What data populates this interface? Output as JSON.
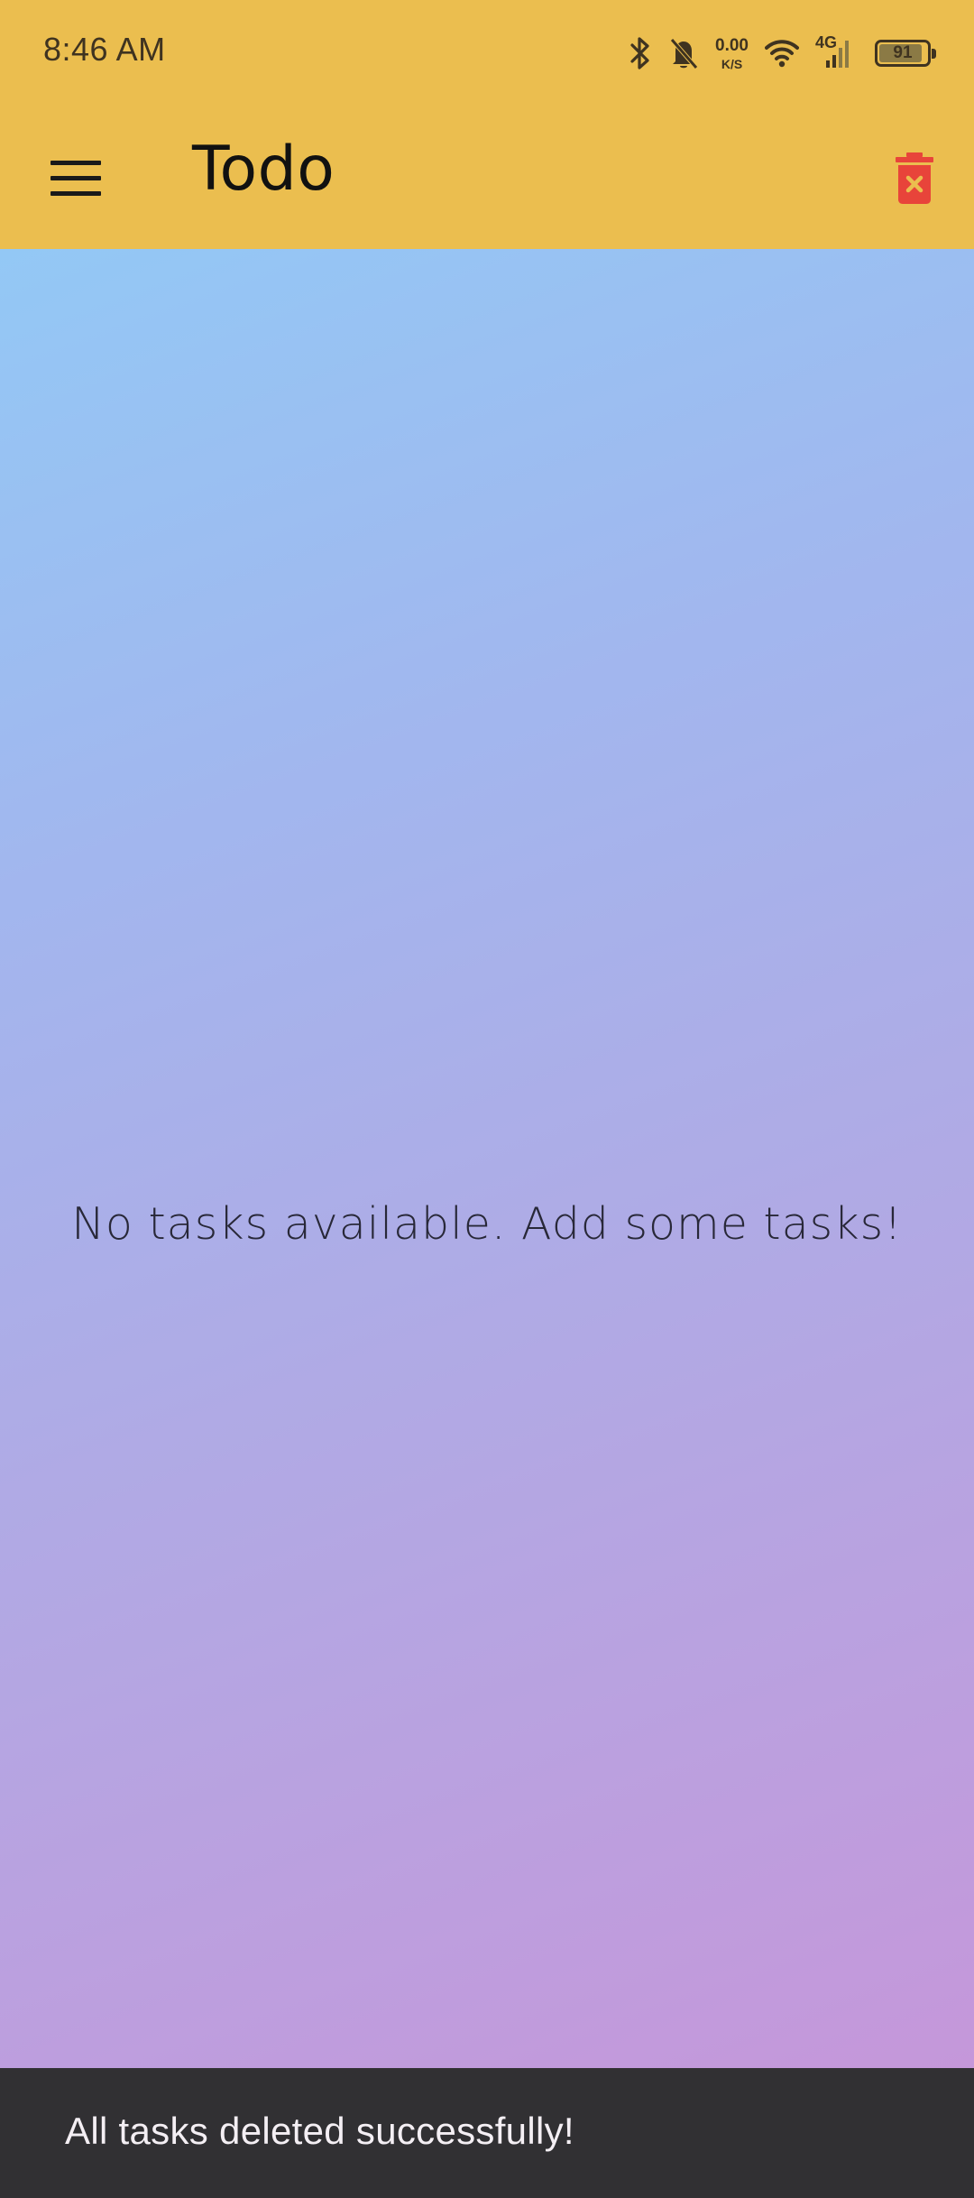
{
  "status_bar": {
    "time": "8:46 AM",
    "network_speed_value": "0.00",
    "network_speed_unit": "K/S",
    "network_type": "4G",
    "battery_level": "91",
    "battery_fraction": 0.91,
    "icons": [
      "bluetooth-icon",
      "bell-off-icon",
      "wifi-icon",
      "signal-icon",
      "battery-icon"
    ]
  },
  "app_bar": {
    "title": "Todo",
    "menu_icon": "menu-icon",
    "delete_icon": "delete-forever-icon"
  },
  "main": {
    "empty_message": "No tasks available. Add some tasks!"
  },
  "fab": {
    "icon": "add-icon"
  },
  "snackbar": {
    "message": "All tasks deleted successfully!"
  },
  "colors": {
    "app_bar": "#EBBE4F",
    "delete_icon": "#E8443A",
    "fab": "#FFCF47",
    "fab_icon": "#21005D",
    "snackbar": "#313033",
    "gradient_start": "#93C8F5",
    "gradient_end": "#C597DA"
  }
}
